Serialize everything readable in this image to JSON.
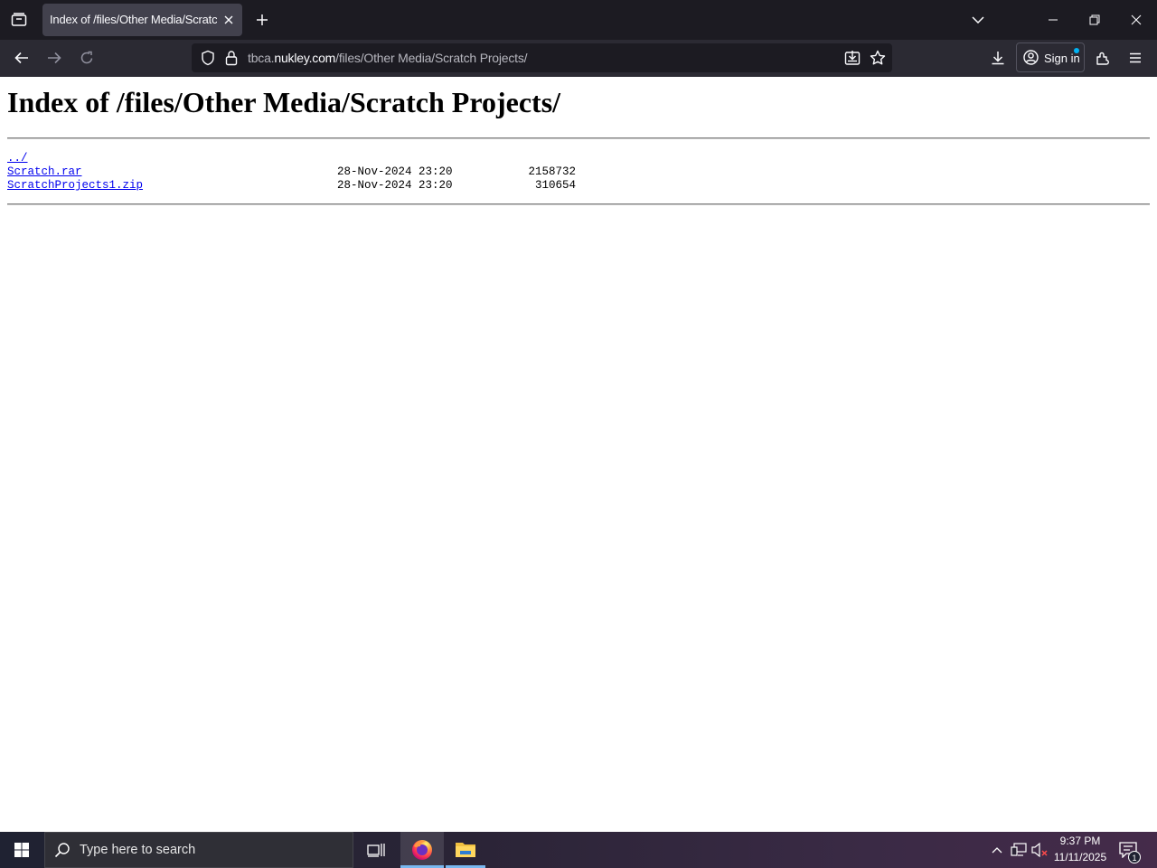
{
  "browser": {
    "tab": {
      "title": "Index of /files/Other Media/Scratch Projects/"
    },
    "url": {
      "host_prefix": "tbca.",
      "host": "nukley.com",
      "path": "/files/Other Media/Scratch Projects/"
    },
    "signin_label": "Sign in",
    "icons": [
      "tab-list-icon",
      "close-icon",
      "plus-icon",
      "chevron-down-icon",
      "minimize-icon",
      "restore-icon",
      "window-close-icon",
      "back-arrow-icon",
      "forward-arrow-icon",
      "reload-icon",
      "shield-icon",
      "lock-icon",
      "save-page-icon",
      "star-icon",
      "download-icon",
      "account-icon",
      "extensions-icon",
      "hamburger-menu-icon"
    ]
  },
  "page": {
    "title": "Index of /files/Other Media/Scratch Projects/",
    "entries": [
      {
        "name": "../",
        "date": "",
        "size": ""
      },
      {
        "name": "Scratch.rar",
        "date": "28-Nov-2024 23:20",
        "size": "2158732"
      },
      {
        "name": "ScratchProjects1.zip",
        "date": "28-Nov-2024 23:20",
        "size": "310654"
      }
    ]
  },
  "taskbar": {
    "search_placeholder": "Type here to search",
    "time": "9:37 PM",
    "date": "11/11/2025",
    "notification_count": "1",
    "icons": [
      "windows-start-icon",
      "search-icon",
      "task-view-icon",
      "firefox-icon",
      "file-explorer-icon",
      "chevron-up-icon",
      "network-icon",
      "volume-muted-icon",
      "notification-icon"
    ]
  },
  "colors": {
    "chrome_dark": "#1c1b22",
    "toolbar": "#2b2a33",
    "active_tab": "#42414d",
    "link": "#0000ee",
    "accent_dot": "#00b3f4"
  }
}
